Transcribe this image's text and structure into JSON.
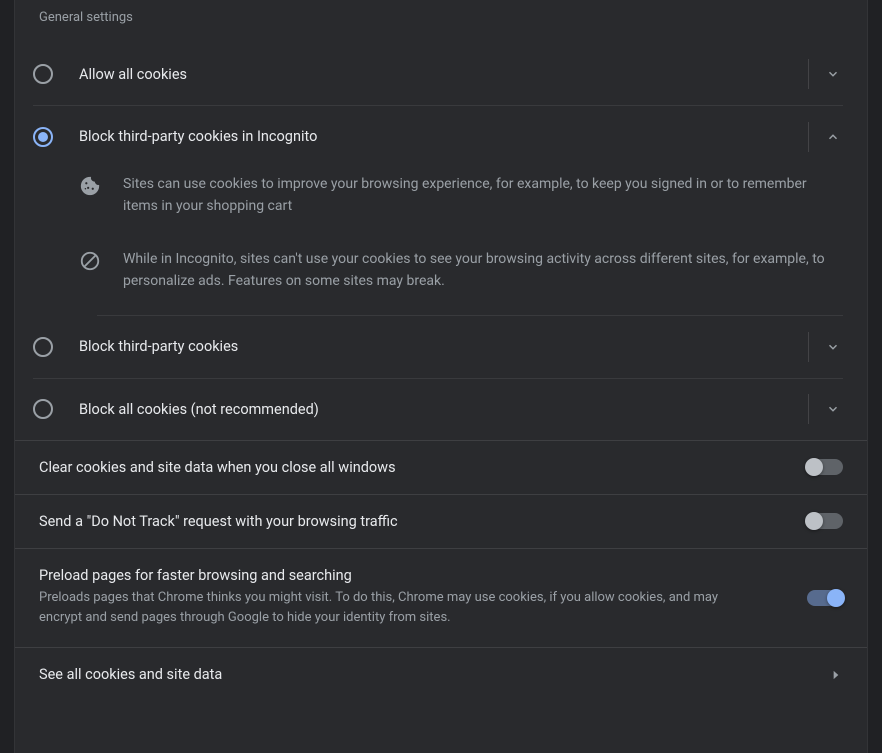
{
  "section_title": "General settings",
  "options": {
    "allow": {
      "label": "Allow all cookies"
    },
    "incognito": {
      "label": "Block third-party cookies in Incognito",
      "detail1": "Sites can use cookies to improve your browsing experience, for example, to keep you signed in or to remember items in your shopping cart",
      "detail2": "While in Incognito, sites can't use your cookies to see your browsing activity across different sites, for example, to personalize ads. Features on some sites may break."
    },
    "third_party": {
      "label": "Block third-party cookies"
    },
    "block_all": {
      "label": "Block all cookies (not recommended)"
    }
  },
  "settings": {
    "clear_on_close": {
      "title": "Clear cookies and site data when you close all windows"
    },
    "do_not_track": {
      "title": "Send a \"Do Not Track\" request with your browsing traffic"
    },
    "preload": {
      "title": "Preload pages for faster browsing and searching",
      "sub": "Preloads pages that Chrome thinks you might visit. To do this, Chrome may use cookies, if you allow cookies, and may encrypt and send pages through Google to hide your identity from sites."
    },
    "see_all": {
      "title": "See all cookies and site data"
    }
  }
}
